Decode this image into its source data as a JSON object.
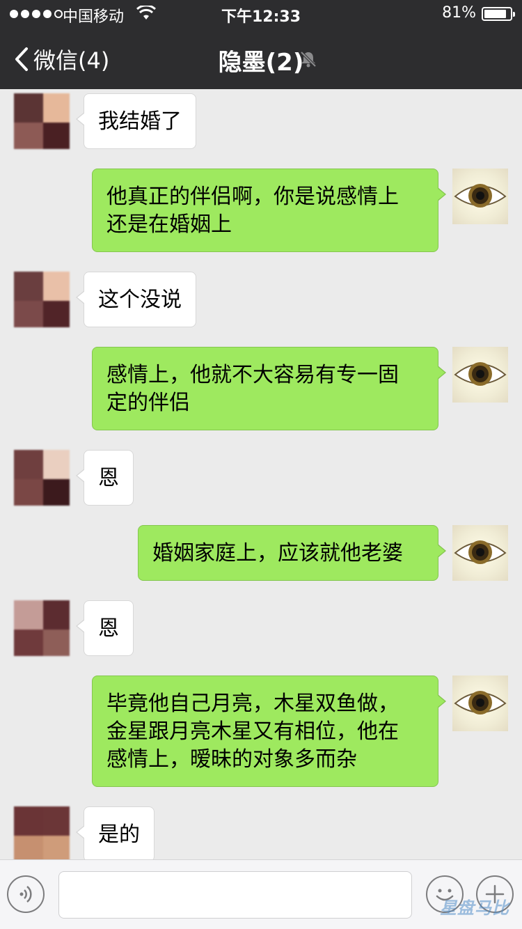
{
  "status_bar": {
    "carrier": "中国移动",
    "time": "下午12:33",
    "battery": "81%",
    "battery_level": 0.81
  },
  "nav": {
    "back_label": "微信(4)",
    "title": "隐墨(2)",
    "muted_icon": "bell-slash-icon"
  },
  "messages": [
    {
      "side": "left",
      "text": "我结婚了"
    },
    {
      "side": "right",
      "lines": [
        "他真正的伴侣啊，你是说感情上",
        "还是在婚姻上"
      ]
    },
    {
      "side": "left",
      "text": "这个没说"
    },
    {
      "side": "right",
      "lines": [
        "感情上，他就不大容易有专一固",
        "定的伴侣"
      ]
    },
    {
      "side": "left",
      "text": "恩"
    },
    {
      "side": "right",
      "lines": [
        "婚姻家庭上，应该就他老婆"
      ]
    },
    {
      "side": "left",
      "text": "恩"
    },
    {
      "side": "right",
      "lines": [
        "毕竟他自己月亮，木星双鱼做，",
        "金星跟月亮木星又有相位，他在",
        "感情上，暧昧的对象多而杂"
      ]
    },
    {
      "side": "left",
      "text": "是的"
    }
  ],
  "input_bar": {
    "voice_icon": "voice-icon",
    "emoji_icon": "emoji-icon",
    "plus_icon": "plus-icon",
    "text_value": ""
  },
  "watermark": "星盘马比"
}
